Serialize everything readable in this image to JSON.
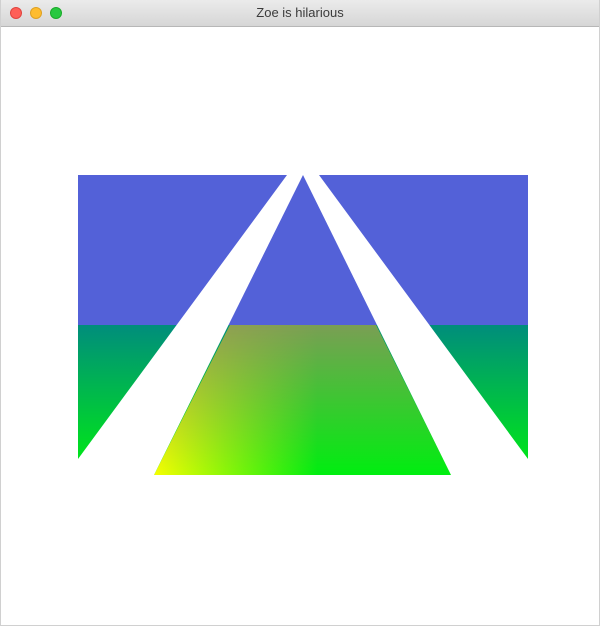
{
  "window": {
    "title": "Zoe is hilarious"
  },
  "controls": {
    "close_icon": "close-icon",
    "minimize_icon": "minimize-icon",
    "zoom_icon": "zoom-icon"
  },
  "scene": {
    "colors": {
      "sky": "#5361d8",
      "teal": "#008d7c",
      "green": "#00ee10",
      "yellow": "#f6ff00",
      "olive": "#909060",
      "gap": "#ffffff"
    }
  }
}
